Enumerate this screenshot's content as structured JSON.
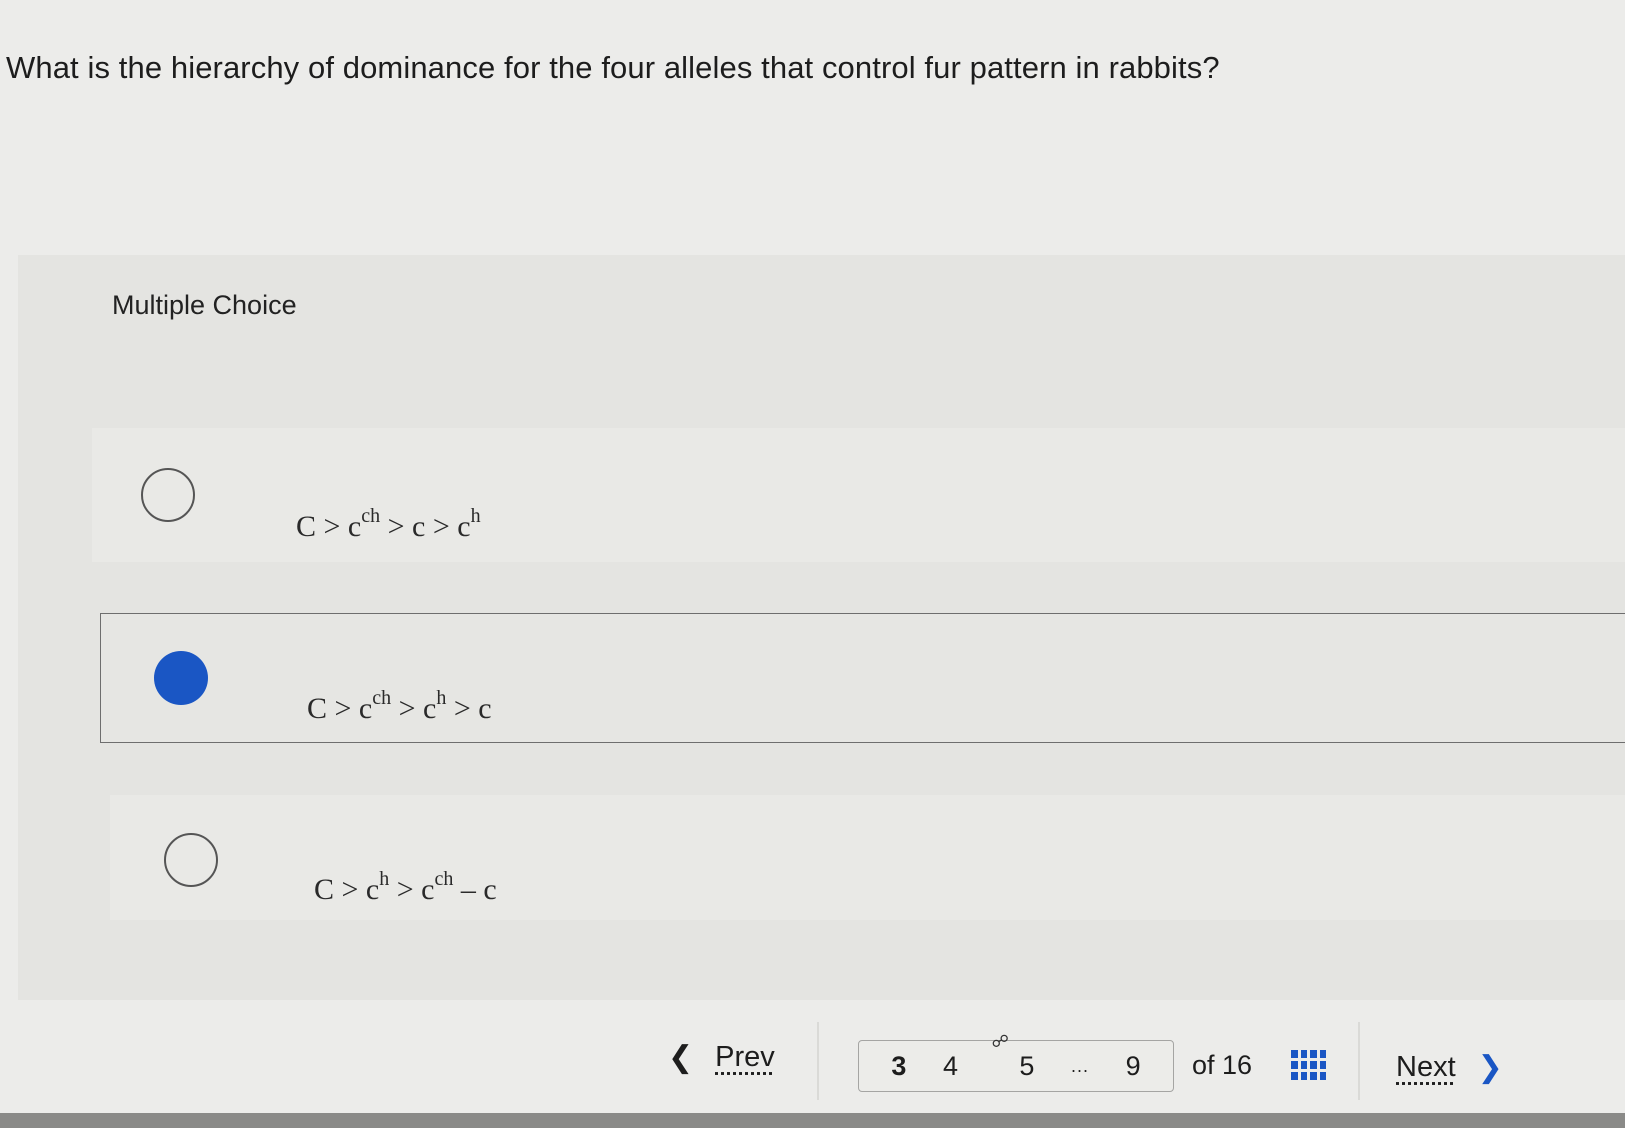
{
  "question": {
    "text": "What is the hierarchy of dominance for the four alleles that control fur pattern in rabbits?"
  },
  "multiple_choice": {
    "label": "Multiple Choice",
    "options": [
      {
        "selected": false,
        "parts": [
          {
            "base": "C > c",
            "sup": "ch"
          },
          {
            "base": " > c > c",
            "sup": "h"
          }
        ]
      },
      {
        "selected": true,
        "parts": [
          {
            "base": "C > c",
            "sup": "ch"
          },
          {
            "base": " > c",
            "sup": "h"
          },
          {
            "base": " > c",
            "sup": ""
          }
        ]
      },
      {
        "selected": false,
        "parts": [
          {
            "base": "C > c",
            "sup": "h"
          },
          {
            "base": " > c",
            "sup": "ch"
          },
          {
            "base": " – c",
            "sup": ""
          }
        ]
      }
    ]
  },
  "navigation": {
    "prev_label": "Prev",
    "next_label": "Next",
    "pages": [
      "3",
      "4",
      "5",
      "...",
      "9"
    ],
    "current_page": "3",
    "total_label": "of 16",
    "icons": {
      "prev": "chevron-left-icon",
      "next": "chevron-right-icon",
      "grid": "grid-icon",
      "link": "link-icon"
    },
    "accent_color": "#1a56c4"
  }
}
